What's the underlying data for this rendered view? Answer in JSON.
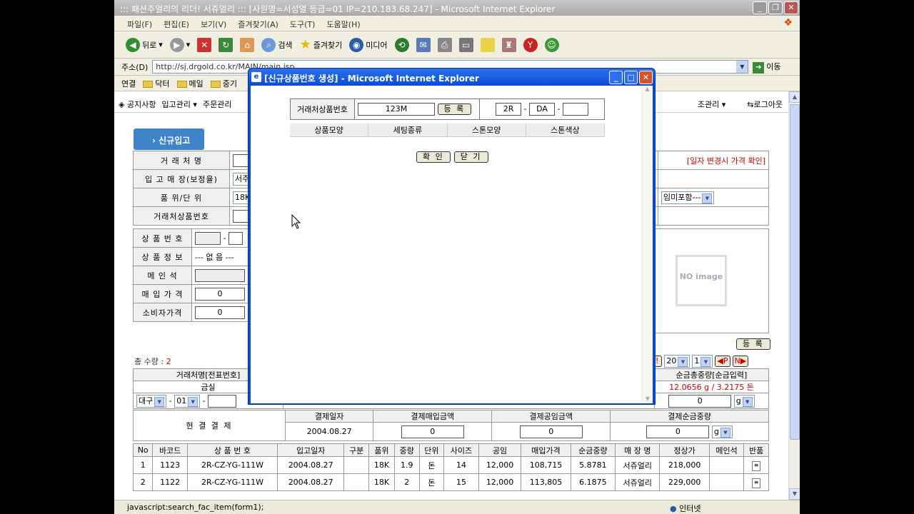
{
  "window": {
    "title": "::: 패션주얼리의 리더! 서쥬얼리 ::: [사원명=서성열 등급=01 IP=210.183.68.247] - Microsoft Internet Explorer",
    "menu": [
      "파일(F)",
      "편집(E)",
      "보기(V)",
      "즐겨찾기(A)",
      "도구(T)",
      "도움말(H)"
    ],
    "toolbar": {
      "back": "뒤로",
      "search": "검색",
      "favorites": "즐겨찾기",
      "media": "미디어"
    },
    "address_label": "주소(D)",
    "address": "http://sj.drgold.co.kr/MAIN/main.jsp",
    "go_label": "이동",
    "links_label": "연결",
    "links": [
      "닥터",
      "메일",
      "중기"
    ],
    "status_text": "javascript:search_fac_item(form1);",
    "zone": "인터넷"
  },
  "nav": {
    "items": [
      "공지사항",
      "입고관리",
      "주문관리"
    ],
    "right_item": "조관리",
    "logout": "로그아웃"
  },
  "page": {
    "section_title": "신규입고",
    "form_labels": [
      "거 래 처 명",
      "입 고 매 장(보정율)",
      "품 위/단 위",
      "거래처상품번호"
    ],
    "store_value": "서주",
    "purity_value": "18K",
    "price_notice": "[일자 변경시 가격 확인]",
    "tax_select": "임미포함---",
    "product_labels": [
      "상 품 번 호",
      "상 품 정 보",
      "메 인 석",
      "매 입 가 격",
      "소비자가격"
    ],
    "product_info_value": "--- 없 음 ---",
    "purchase_price": "0",
    "consumer_price": "0",
    "no_image": "NO image",
    "register_button": "등 록",
    "total_label": "총 수량 : ",
    "total_count": "2",
    "page_size": "20",
    "page_num": "1",
    "prev": "◀P",
    "next": "N▶",
    "summary_header_left": "거래처명[전표번호]",
    "summary_header_right": "순금총중량[순금입력]",
    "gold_label": "금실",
    "weight_summary": "12.0656 g / 3.2175 돈",
    "region_select": "대구",
    "code_select": "01",
    "weight_input": "0",
    "unit_select": "g",
    "payment_label": "현 결 결 제",
    "payment_headers": [
      "결제일자",
      "결제매입금액",
      "결제공임금액",
      "결제순금중량"
    ],
    "payment_date": "2004.08.27",
    "payment_values": [
      "0",
      "0",
      "0"
    ]
  },
  "table": {
    "headers": [
      "No",
      "바코드",
      "상 품 번 호",
      "입고일자",
      "구분",
      "품위",
      "중량",
      "단위",
      "사이즈",
      "공임",
      "매입가격",
      "순금중량",
      "매 장 명",
      "정상가",
      "메인석",
      "반품"
    ],
    "rows": [
      [
        "1",
        "1123",
        "2R-CZ-YG-111W",
        "2004.08.27",
        "",
        "18K",
        "1.9",
        "돈",
        "14",
        "12,000",
        "108,715",
        "5.8781",
        "서쥬얼리",
        "218,000",
        ""
      ],
      [
        "2",
        "1122",
        "2R-CZ-YG-111W",
        "2004.08.27",
        "",
        "18K",
        "2",
        "돈",
        "15",
        "12,000",
        "113,805",
        "6.1875",
        "서쥬얼리",
        "229,000",
        ""
      ]
    ]
  },
  "popup": {
    "title": "[신규상품번호 생성] - Microsoft Internet Explorer",
    "vendor_label": "거래처상품번호",
    "vendor_value": "123M",
    "register": "등 록",
    "code1": "2R",
    "code2": "DA",
    "code3": "",
    "headers": [
      "상품모양",
      "세팅종류",
      "스톤모양",
      "스톤색상"
    ],
    "confirm": "확 인",
    "close": "닫 기"
  },
  "colors": {
    "accent": "#0a4bd6",
    "section_tab": "#3f84c9",
    "notice": "#cc0000"
  }
}
